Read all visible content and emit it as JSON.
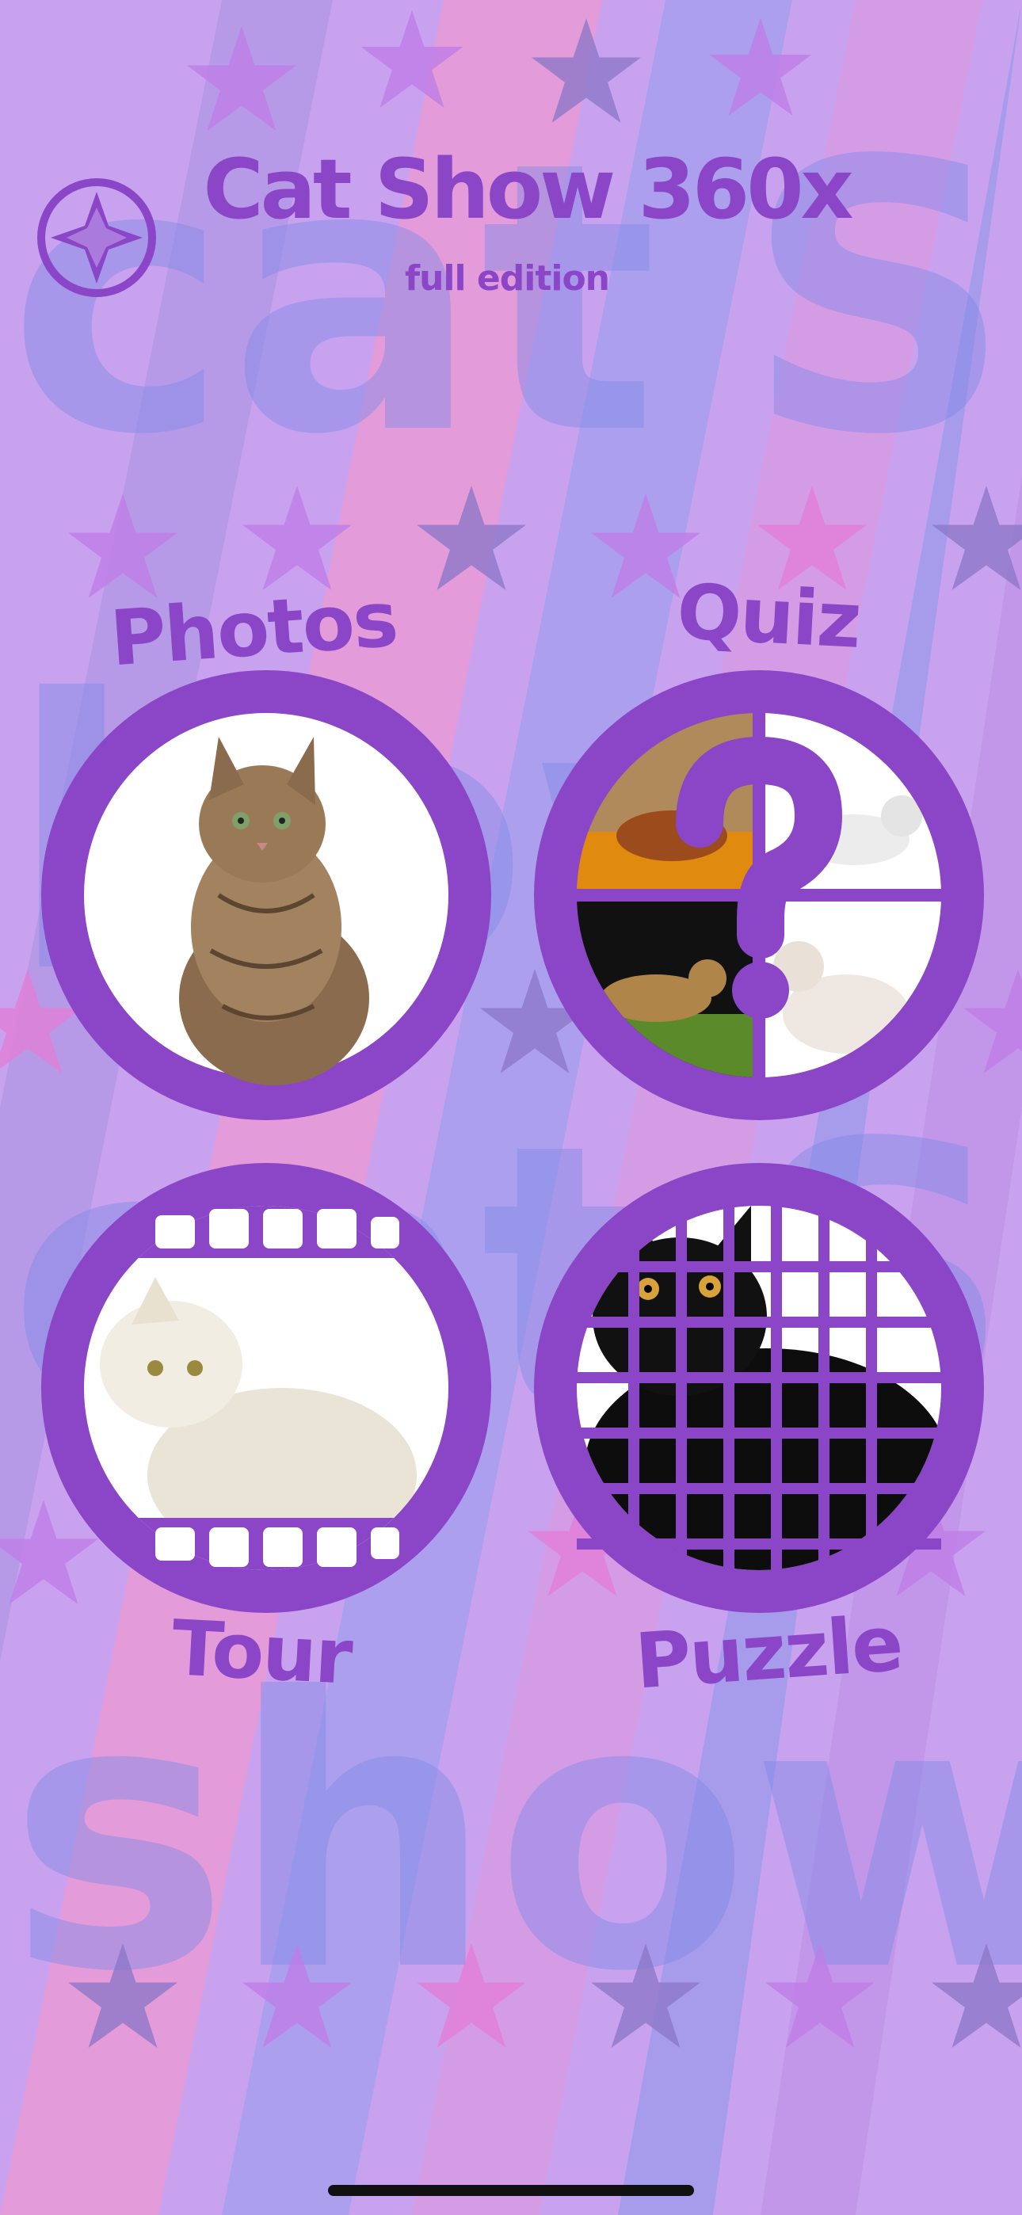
{
  "header": {
    "title": "Cat Show 360x",
    "subtitle": "full edition",
    "menu_icon": "compass-icon"
  },
  "tiles": [
    {
      "label": "Photos",
      "icon": "cat-photo-icon"
    },
    {
      "label": "Quiz",
      "icon": "question-mark-icon"
    },
    {
      "label": "Tour",
      "icon": "film-strip-icon"
    },
    {
      "label": "Puzzle",
      "icon": "puzzle-grid-icon"
    }
  ],
  "background_text": [
    "cat",
    "show"
  ],
  "colors": {
    "accent": "#8a46c6",
    "background": "#c9a2ef",
    "stripe_pink": "#e08fd6",
    "stripe_blue": "#9f9cf0"
  }
}
